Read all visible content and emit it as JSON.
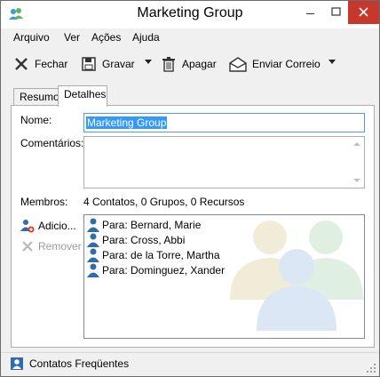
{
  "window": {
    "title": "Marketing Group"
  },
  "menu": [
    "Arquivo",
    "Ver",
    "Ações",
    "Ajuda"
  ],
  "toolbar": {
    "close_label": "Fechar",
    "save_label": "Gravar",
    "delete_label": "Apagar",
    "send_label": "Enviar Correio"
  },
  "tabs": [
    {
      "label": "Resumo",
      "active": false
    },
    {
      "label": "Detalhes",
      "active": true
    }
  ],
  "form": {
    "name_label": "Nome:",
    "name_value": "Marketing Group",
    "comments_label": "Comentários:",
    "comments_value": "",
    "members_label": "Membros:",
    "members_summary": "4 Contatos, 0 Grupos, 0 Recursos",
    "add_label": "Adicio...",
    "remove_label": "Remover"
  },
  "members": [
    "Para: Bernard, Marie",
    "Para: Cross, Abbi",
    "Para: de la Torre, Martha",
    "Para: Dominguez, Xander"
  ],
  "status": {
    "text": "Contatos Freqüentes"
  },
  "colors": {
    "close_button": "#c7372c",
    "selection": "#3399ff",
    "input_focus_border": "#5b9bd5",
    "person_icon": "#2f6ca8"
  }
}
